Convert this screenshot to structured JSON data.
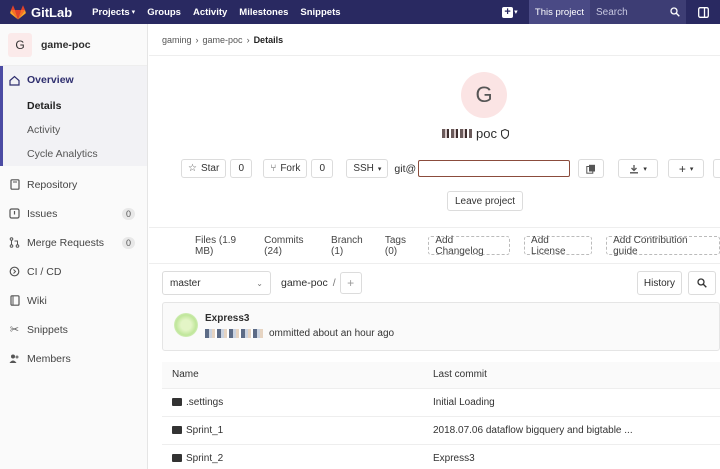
{
  "topbar": {
    "app_name": "GitLab",
    "nav": [
      {
        "label": "Projects",
        "has_dropdown": true
      },
      {
        "label": "Groups",
        "has_dropdown": false
      },
      {
        "label": "Activity",
        "has_dropdown": false
      },
      {
        "label": "Milestones",
        "has_dropdown": false
      },
      {
        "label": "Snippets",
        "has_dropdown": false
      }
    ],
    "search_scope": "This project",
    "search_placeholder": "Search",
    "colors": {
      "topbar_bg": "#292961",
      "logo": "#fc6d26"
    }
  },
  "sidebar": {
    "project_initial": "G",
    "project_name": "game-poc",
    "overview": {
      "label": "Overview",
      "subitems": [
        "Details",
        "Activity",
        "Cycle Analytics"
      ],
      "current": "Details"
    },
    "items": [
      {
        "label": "Repository",
        "icon": "repository-icon"
      },
      {
        "label": "Issues",
        "icon": "issues-icon",
        "count": "0"
      },
      {
        "label": "Merge Requests",
        "icon": "merge-request-icon",
        "count": "0"
      },
      {
        "label": "CI / CD",
        "icon": "rocket-icon"
      },
      {
        "label": "Wiki",
        "icon": "book-icon"
      },
      {
        "label": "Snippets",
        "icon": "scissors-icon"
      },
      {
        "label": "Members",
        "icon": "users-icon"
      }
    ]
  },
  "breadcrumb": {
    "group": "gaming",
    "project": "game-poc",
    "current": "Details"
  },
  "project": {
    "initial": "G",
    "name_suffix": "poc",
    "star_label": "Star",
    "star_count": "0",
    "fork_label": "Fork",
    "fork_count": "0",
    "protocol": "SSH",
    "clone_prefix": "git@",
    "leave_label": "Leave project"
  },
  "filebar": {
    "files": "Files (1.9 MB)",
    "commits": "Commits (24)",
    "branches": "Branch (1)",
    "tags": "Tags (0)",
    "add_changelog": "Add Changelog",
    "add_license": "Add License",
    "add_contrib": "Add Contribution guide"
  },
  "branch": {
    "selected": "master",
    "path": "game-poc",
    "history_label": "History"
  },
  "commit": {
    "title": "Express3",
    "meta": "ommitted about an hour ago"
  },
  "table": {
    "headers": [
      "Name",
      "Last commit"
    ],
    "rows": [
      {
        "name": ".settings",
        "commit": "Initial Loading"
      },
      {
        "name": "Sprint_1",
        "commit": "2018.07.06 dataflow bigquery and bigtable ..."
      },
      {
        "name": "Sprint_2",
        "commit": "Express3"
      }
    ]
  }
}
